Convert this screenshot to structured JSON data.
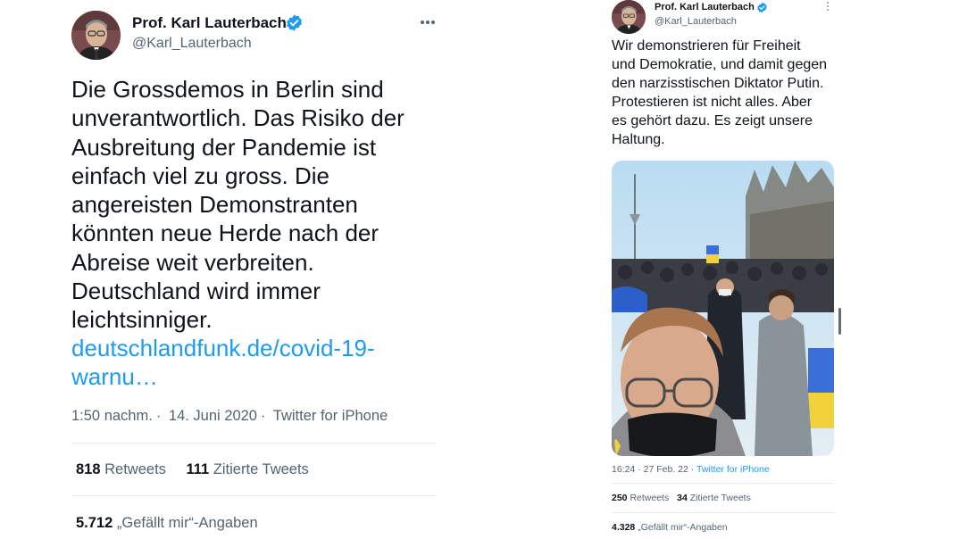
{
  "left_tweet": {
    "author_name": "Prof. Karl Lauterbach",
    "handle": "@Karl_Lauterbach",
    "more_icon": "more-horizontal-icon",
    "text_lines": [
      "Die Grossdemos in Berlin sind",
      "unverantwortlich. Das Risiko der",
      "Ausbreitung der Pandemie ist",
      "einfach viel zu gross. Die",
      "angereisten Demonstranten",
      "könnten neue Herde nach der",
      "Abreise weit verbreiten.",
      "Deutschland wird immer",
      "leichtsinniger."
    ],
    "link_lines": [
      "deutschlandfunk.de/covid-19-",
      "warnu…"
    ],
    "time": "1:50 nachm.",
    "date": "14. Juni 2020",
    "source": "Twitter for iPhone",
    "retweets_count": "818",
    "retweets_label": "Retweets",
    "quotes_count": "111",
    "quotes_label": "Zitierte Tweets",
    "likes_count": "5.712",
    "likes_label": "„Gefällt mir“-Angaben"
  },
  "right_tweet": {
    "author_name": "Prof. Karl Lauterbach",
    "handle": "@Karl_Lauterbach",
    "text_lines": [
      "Wir demonstrieren für Freiheit",
      "und Demokratie, und damit gegen",
      "den narzisstischen Diktator Putin.",
      "Protestieren ist nicht alles. Aber",
      "es gehört dazu. Es zeigt unsere",
      "Haltung."
    ],
    "time": "16:24",
    "date": "27 Feb. 22",
    "source": "Twitter for iPhone",
    "retweets_count": "250",
    "retweets_label": "Retweets",
    "quotes_count": "34",
    "quotes_label": "Zitierte Tweets",
    "likes_count": "4.328",
    "likes_label": "„Gefällt mir“-Angaben"
  },
  "colors": {
    "text": "#0f1419",
    "secondary": "#536471",
    "link": "#1d9bf0",
    "verified": "#1d9bf0",
    "divider": "#e6ecf0"
  }
}
